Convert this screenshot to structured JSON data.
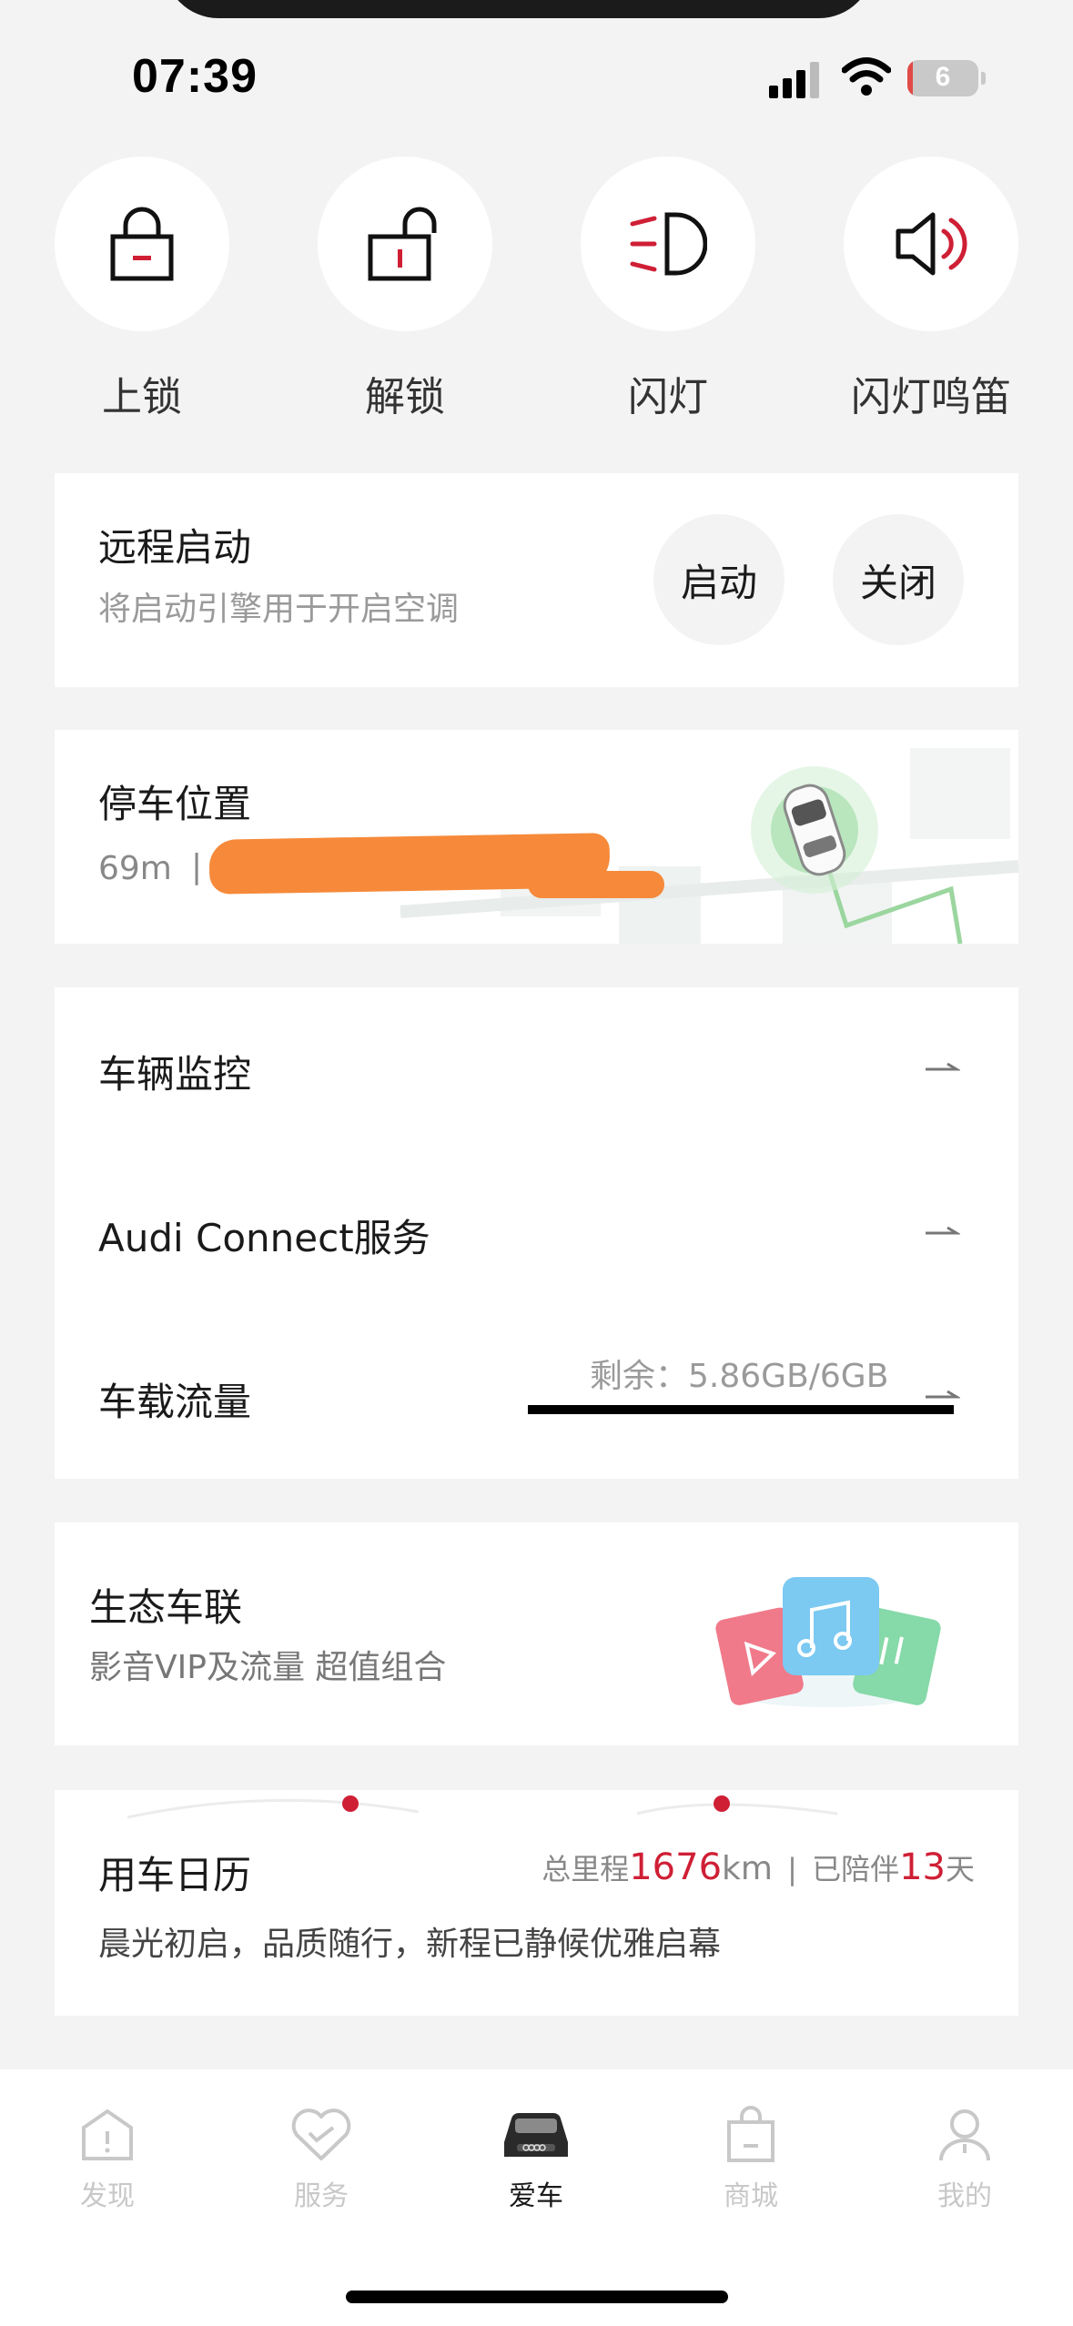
{
  "status_bar": {
    "time": "07:39",
    "battery": "6"
  },
  "quick_actions": [
    {
      "label": "上锁",
      "icon": "lock-icon"
    },
    {
      "label": "解锁",
      "icon": "unlock-icon"
    },
    {
      "label": "闪灯",
      "icon": "headlight-icon"
    },
    {
      "label": "闪灯鸣笛",
      "icon": "horn-icon"
    }
  ],
  "remote_start": {
    "title": "远程启动",
    "subtitle": "将启动引擎用于开启空调",
    "start_label": "启动",
    "stop_label": "关闭"
  },
  "parking": {
    "title": "停车位置",
    "distance": "69m",
    "separator": "|"
  },
  "menu": {
    "monitor": "车辆监控",
    "connect": "Audi Connect服务",
    "data": "车载流量",
    "data_remaining_label": "剩余：",
    "data_remaining_value": "5.86GB/6GB"
  },
  "eco": {
    "title": "生态车联",
    "subtitle": "影音VIP及流量 超值组合"
  },
  "calendar": {
    "title": "用车日历",
    "mileage_label": "总里程",
    "mileage_value": "1676",
    "mileage_unit": "km",
    "divider": "|",
    "days_label": "已陪伴",
    "days_value": "13",
    "days_unit": "天",
    "slogan": "晨光初启，品质随行，新程已静候优雅启幕"
  },
  "nav": [
    {
      "label": "发现",
      "icon": "discover-icon"
    },
    {
      "label": "服务",
      "icon": "heart-service-icon"
    },
    {
      "label": "爱车",
      "icon": "car-icon"
    },
    {
      "label": "商城",
      "icon": "shopping-bag-icon"
    },
    {
      "label": "我的",
      "icon": "person-icon"
    }
  ],
  "colors": {
    "accent": "#cf1f35",
    "background": "#f3f3f3",
    "card": "#ffffff",
    "muted": "#9a9a9a"
  }
}
